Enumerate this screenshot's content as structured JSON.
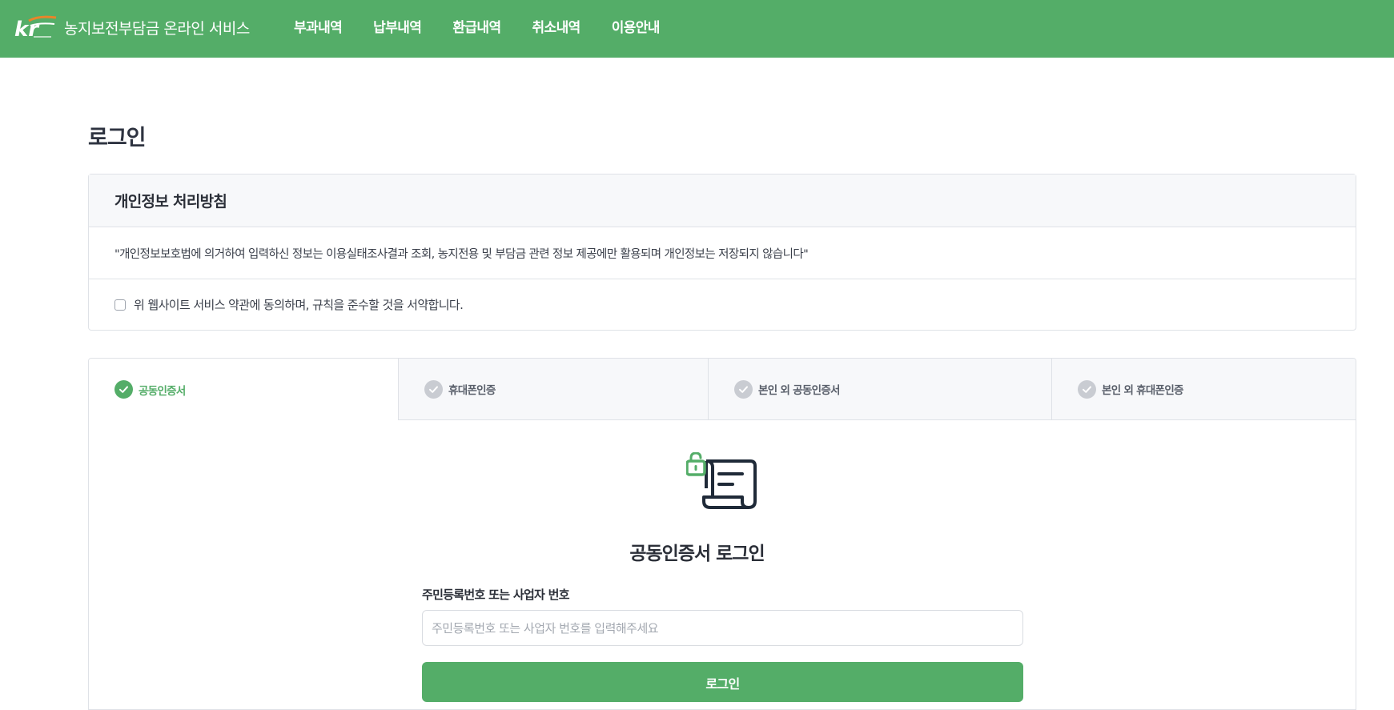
{
  "header": {
    "logo_text": "kr",
    "site_title": "농지보전부담금 온라인 서비스",
    "nav": [
      "부과내역",
      "납부내역",
      "환급내역",
      "취소내역",
      "이용안내"
    ]
  },
  "page": {
    "title": "로그인"
  },
  "privacy": {
    "title": "개인정보 처리방침",
    "notice": "\"개인정보보호법에 의거하여 입력하신 정보는 이용실태조사결과 조회, 농지전용 및 부담금 관련 정보 제공에만 활용되며 개인정보는 저장되지 않습니다\"",
    "agree_label": "위 웹사이트 서비스 약관에 동의하며, 규칙을 준수할 것을 서약합니다.",
    "agree_checked": false
  },
  "tabs": [
    {
      "label": "공동인증서",
      "active": true
    },
    {
      "label": "휴대폰인증",
      "active": false
    },
    {
      "label": "본인 외 공동인증서",
      "active": false
    },
    {
      "label": "본인 외 휴대폰인증",
      "active": false
    }
  ],
  "login_form": {
    "title": "공동인증서 로그인",
    "field_label": "주민등록번호 또는 사업자 번호",
    "input_value": "",
    "input_placeholder": "주민등록번호 또는 사업자 번호를 입력해주세요",
    "submit_label": "로그인"
  },
  "colors": {
    "brand_green": "#54ad68",
    "tab_inactive_check": "#c9ccd2",
    "text_dark": "#2b2f38",
    "logo_orange": "#e8852a"
  },
  "icons": {
    "logo": "kr-logo",
    "tab_check": "check-circle-icon",
    "certificate": "certificate-scroll-with-unlocked-padlock-icon"
  }
}
